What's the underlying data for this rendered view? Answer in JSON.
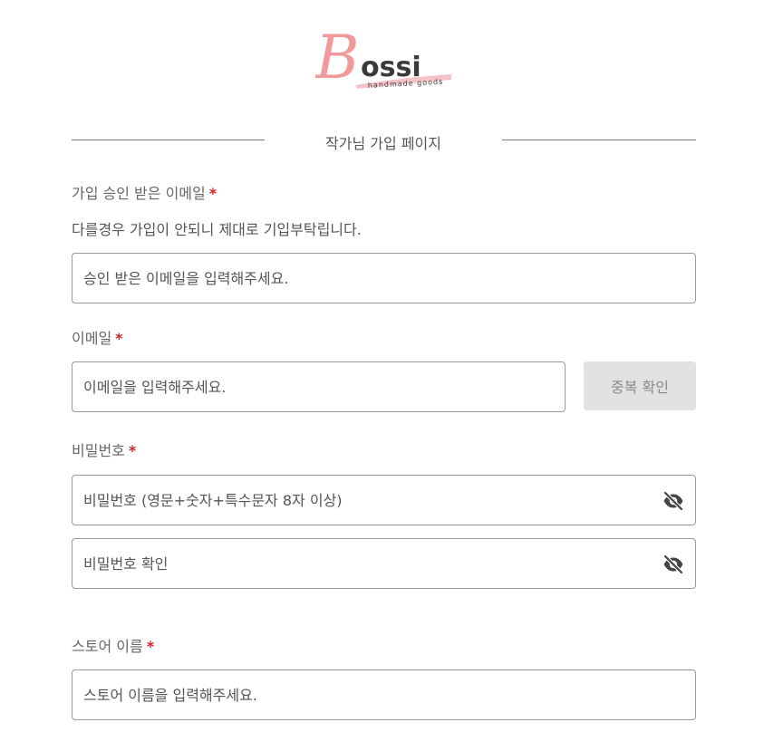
{
  "logo": {
    "initial": "B",
    "rest": "ossi",
    "tagline": "handmade goods",
    "colors": {
      "initial": "#f29a9a",
      "text": "#3a3a3a",
      "brush": "#f3b8bd"
    }
  },
  "page_title": "작가님 가입 페이지",
  "required_mark": "*",
  "approved_email": {
    "label": "가입 승인 받은 이메일",
    "hint": "다를경우 가입이 안되니 제대로 기입부탁립니다.",
    "placeholder": "승인 받은 이메일을 입력해주세요."
  },
  "email": {
    "label": "이메일",
    "placeholder": "이메일을 입력해주세요.",
    "check_button": "중복 확인"
  },
  "password": {
    "label": "비밀번호",
    "placeholder": "비밀번호 (영문+숫자+특수문자 8자 이상)",
    "confirm_placeholder": "비밀번호 확인",
    "toggle_icon": "eye-off-icon"
  },
  "store_name": {
    "label": "스토어 이름",
    "placeholder": "스토어 이름을 입력해주세요."
  },
  "colors": {
    "required": "#d81f26",
    "border": "#999999",
    "button_bg": "#e2e2e2",
    "button_text": "#8a8a8a"
  }
}
